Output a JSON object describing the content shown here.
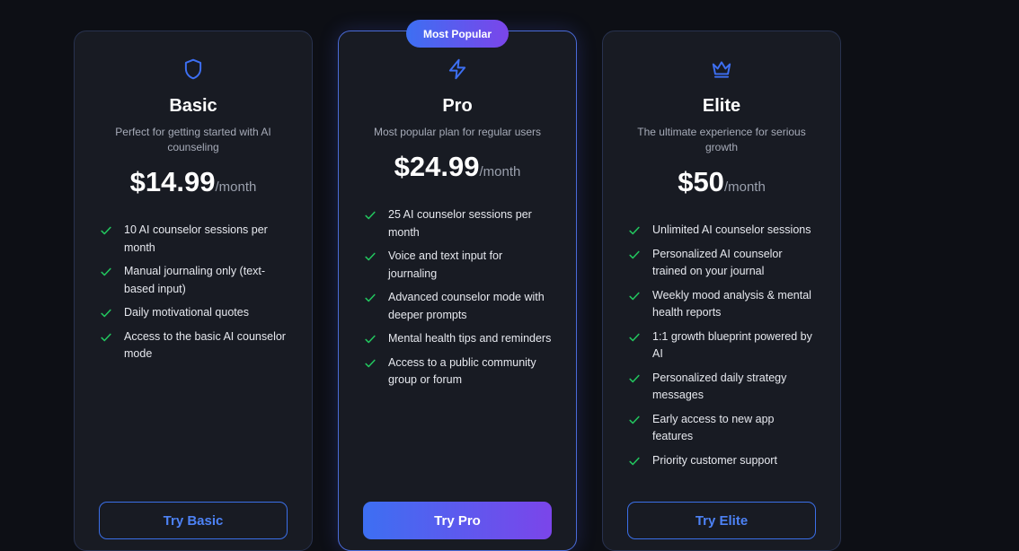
{
  "colors": {
    "accent_blue": "#3d6ff2",
    "accent_purple": "#7b45ea",
    "check_green": "#22c55e",
    "card_bg": "#181b23",
    "page_bg": "#0d0f15"
  },
  "plans": [
    {
      "icon": "shield-icon",
      "name": "Basic",
      "description": "Perfect for getting started with AI counseling",
      "price": "$14.99",
      "period": "/month",
      "features": [
        "10 AI counselor sessions per month",
        "Manual journaling only (text-based input)",
        "Daily motivational quotes",
        "Access to the basic AI counselor mode"
      ],
      "button": "Try Basic"
    },
    {
      "badge": "Most Popular",
      "icon": "lightning-icon",
      "name": "Pro",
      "description": "Most popular plan for regular users",
      "price": "$24.99",
      "period": "/month",
      "features": [
        "25 AI counselor sessions per month",
        "Voice and text input for journaling",
        "Advanced counselor mode with deeper prompts",
        "Mental health tips and reminders",
        "Access to a public community group or forum"
      ],
      "button": "Try Pro"
    },
    {
      "icon": "crown-icon",
      "name": "Elite",
      "description": "The ultimate experience for serious growth",
      "price": "$50",
      "period": "/month",
      "features": [
        "Unlimited AI counselor sessions",
        "Personalized AI counselor trained on your journal",
        "Weekly mood analysis & mental health reports",
        "1:1 growth blueprint powered by AI",
        "Personalized daily strategy messages",
        "Early access to new app features",
        "Priority customer support"
      ],
      "button": "Try Elite"
    }
  ]
}
